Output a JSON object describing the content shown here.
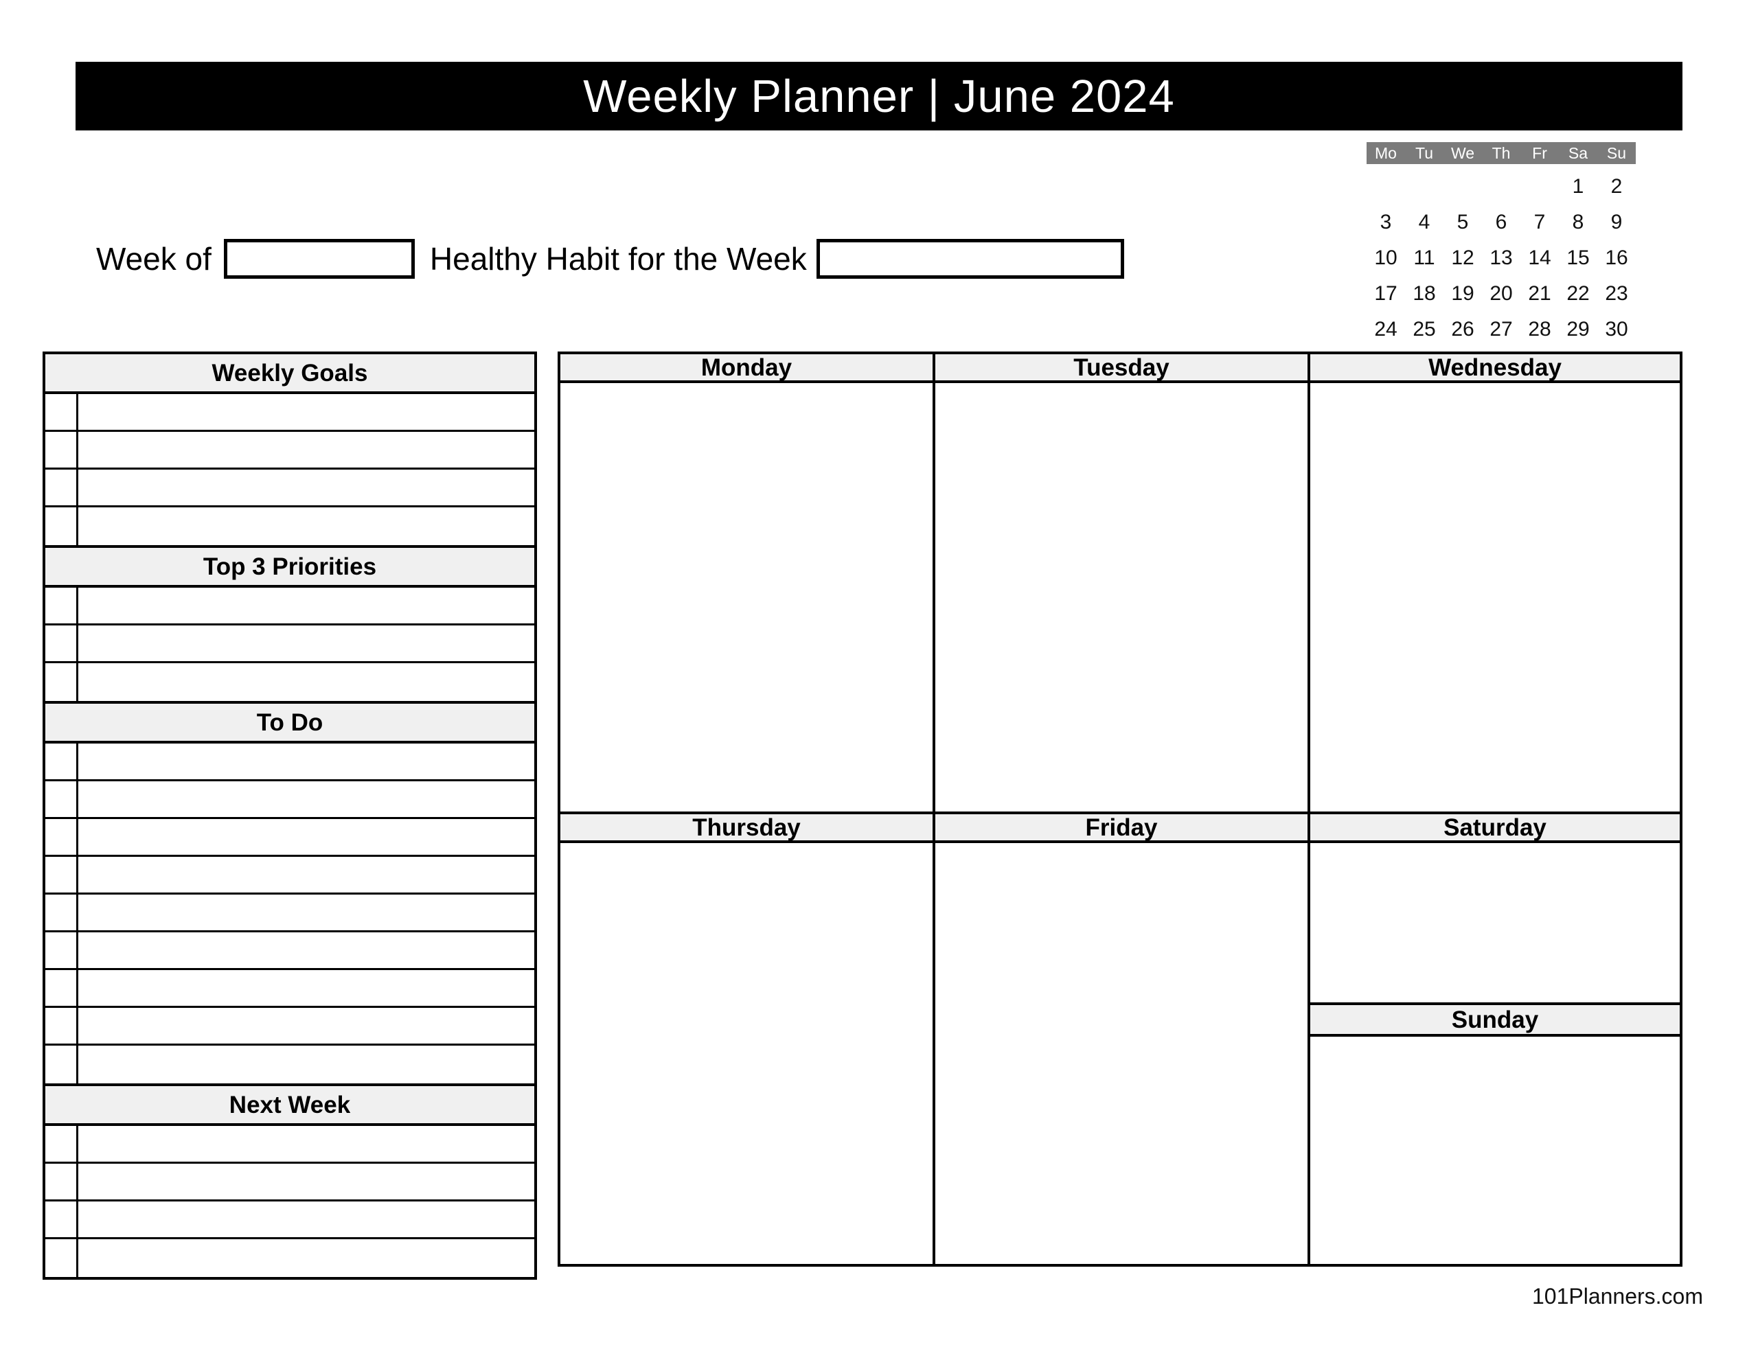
{
  "header": {
    "title": "Weekly Planner | June 2024"
  },
  "mini_calendar": {
    "weekday_labels": [
      "Mo",
      "Tu",
      "We",
      "Th",
      "Fr",
      "Sa",
      "Su"
    ],
    "cells": [
      "",
      "",
      "",
      "",
      "",
      "1",
      "2",
      "3",
      "4",
      "5",
      "6",
      "7",
      "8",
      "9",
      "10",
      "11",
      "12",
      "13",
      "14",
      "15",
      "16",
      "17",
      "18",
      "19",
      "20",
      "21",
      "22",
      "23",
      "24",
      "25",
      "26",
      "27",
      "28",
      "29",
      "30"
    ],
    "header_bg": "#7b7b7b"
  },
  "week_row": {
    "week_of_label": "Week of",
    "week_of_value": "",
    "habit_label": "Healthy Habit for the Week",
    "habit_value": ""
  },
  "left_column": {
    "sections": [
      {
        "title": "Weekly Goals",
        "rows": 4
      },
      {
        "title": "Top 3 Priorities",
        "rows": 3
      },
      {
        "title": "To Do",
        "rows": 9
      },
      {
        "title": "Next Week",
        "rows": 4
      }
    ]
  },
  "days": {
    "monday": "Monday",
    "tuesday": "Tuesday",
    "wednesday": "Wednesday",
    "thursday": "Thursday",
    "friday": "Friday",
    "saturday": "Saturday",
    "sunday": "Sunday"
  },
  "footer": {
    "site": "101Planners.com"
  },
  "colors": {
    "header_bar": "#000000",
    "section_head_bg": "#f0f0f0",
    "calendar_head_bg": "#7b7b7b",
    "border": "#000000"
  }
}
